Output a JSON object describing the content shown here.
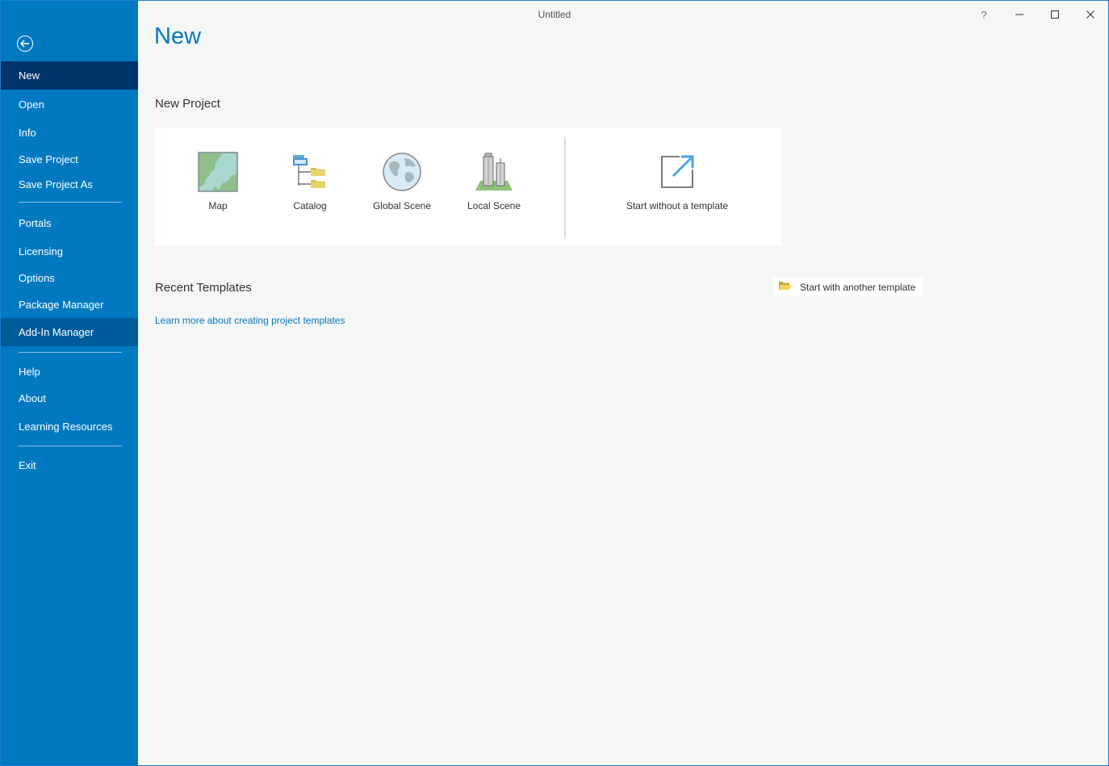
{
  "window": {
    "title": "Untitled",
    "help_label": "?",
    "minimize_label": "—",
    "maximize_label": "☐",
    "close_label": "✕"
  },
  "sidebar": {
    "items": [
      {
        "label": "New"
      },
      {
        "label": "Open"
      },
      {
        "label": "Info"
      },
      {
        "label": "Save Project"
      },
      {
        "label": "Save Project As"
      },
      {
        "label": "Portals"
      },
      {
        "label": "Licensing"
      },
      {
        "label": "Options"
      },
      {
        "label": "Package Manager"
      },
      {
        "label": "Add-In Manager"
      },
      {
        "label": "Help"
      },
      {
        "label": "About"
      },
      {
        "label": "Learning Resources"
      },
      {
        "label": "Exit"
      }
    ],
    "selected": "New",
    "highlighted": "Add-In Manager"
  },
  "main": {
    "page_title": "New",
    "new_project": {
      "heading": "New Project",
      "templates": [
        {
          "label": "Map",
          "icon": "map-icon"
        },
        {
          "label": "Catalog",
          "icon": "catalog-icon"
        },
        {
          "label": "Global Scene",
          "icon": "globe-icon"
        },
        {
          "label": "Local Scene",
          "icon": "local-scene-icon"
        }
      ],
      "blank": {
        "label": "Start without a template",
        "icon": "start-blank-icon"
      }
    },
    "recent_templates": {
      "heading": "Recent Templates",
      "another_template_label": "Start with another template",
      "learn_more_link": "Learn more about creating project templates"
    }
  },
  "colors": {
    "sidebar": "#0079c1",
    "sidebar_selected": "#00346b",
    "accent": "#0079c1",
    "background": "#f5f6f6"
  }
}
